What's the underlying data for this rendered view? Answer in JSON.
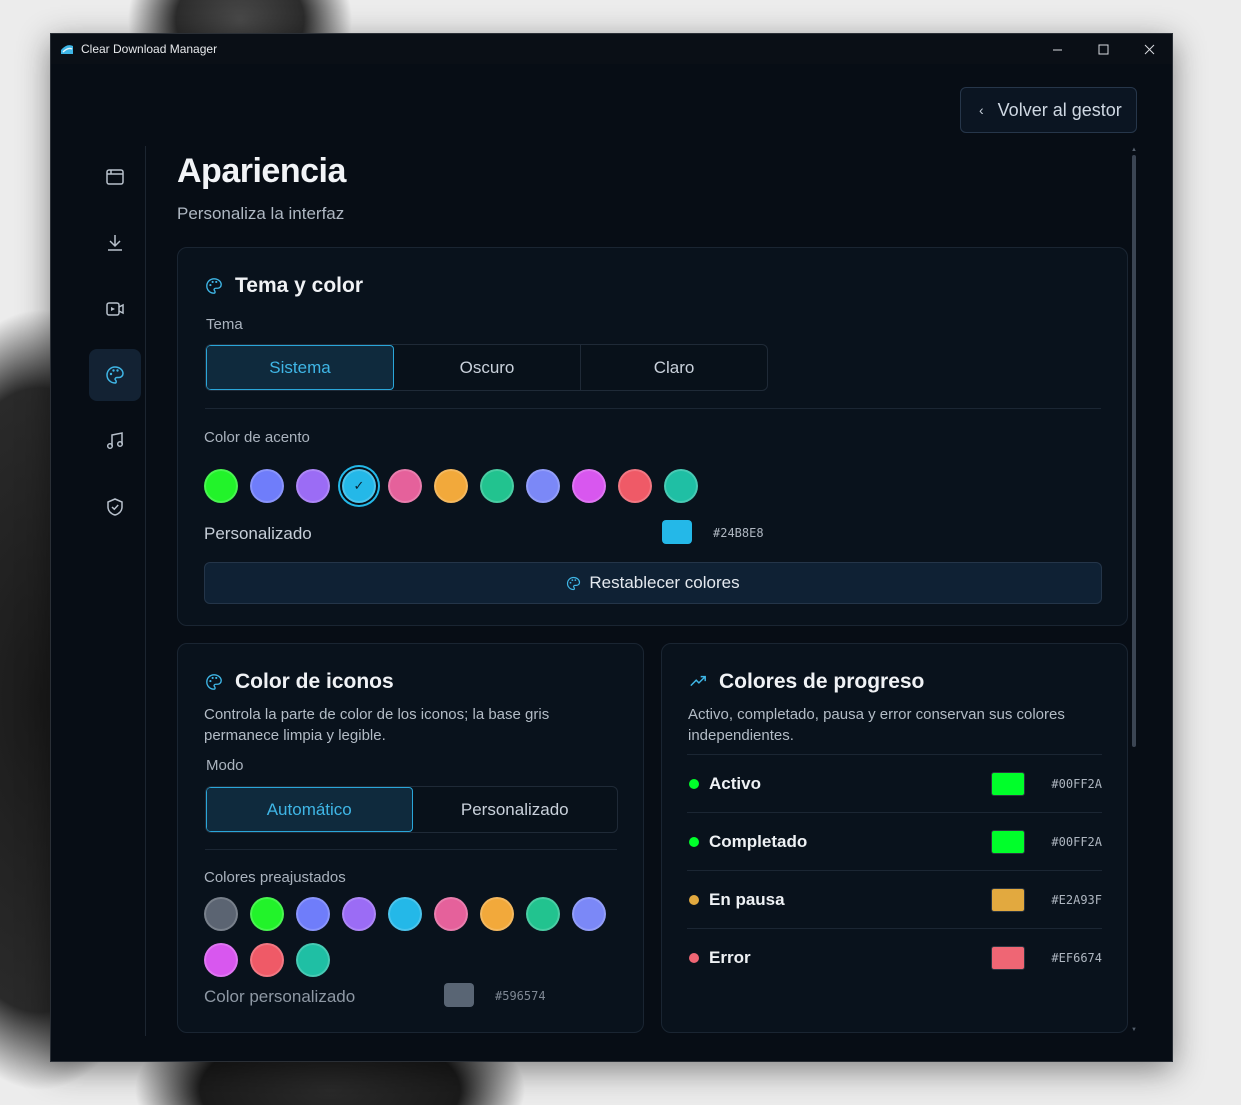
{
  "window": {
    "title": "Clear Download Manager"
  },
  "header": {
    "back_label": "Volver al gestor"
  },
  "sidebar": {
    "items": [
      {
        "name": "browser-window-icon",
        "active": false
      },
      {
        "name": "download-icon",
        "active": false
      },
      {
        "name": "video-icon",
        "active": false
      },
      {
        "name": "palette-icon",
        "active": true
      },
      {
        "name": "music-icon",
        "active": false
      },
      {
        "name": "shield-icon",
        "active": false
      }
    ]
  },
  "page": {
    "title": "Apariencia",
    "subtitle": "Personaliza la interfaz"
  },
  "theme_card": {
    "title": "Tema y color",
    "theme_label": "Tema",
    "themes": [
      "Sistema",
      "Oscuro",
      "Claro"
    ],
    "selected_theme": "Sistema",
    "accent_label": "Color de acento",
    "accent_colors": [
      "#22f32a",
      "#6f7dfa",
      "#9b6cf5",
      "#24b8e8",
      "#e5619b",
      "#f2a93b",
      "#22c38f",
      "#7b88f7",
      "#d857ef",
      "#ef5a67",
      "#1fbfa4"
    ],
    "selected_accent_index": 3,
    "custom_label": "Personalizado",
    "custom_color": "#24B8E8",
    "reset_label": "Restablecer colores"
  },
  "icon_card": {
    "title": "Color de iconos",
    "description": "Controla la parte de color de los iconos; la base gris permanece limpia y legible.",
    "mode_label": "Modo",
    "modes": [
      "Automático",
      "Personalizado"
    ],
    "selected_mode": "Automático",
    "presets_label": "Colores preajustados",
    "preset_colors": [
      "#5b6472",
      "#22f32a",
      "#6f7dfa",
      "#9b6cf5",
      "#24b8e8",
      "#e5619b",
      "#f2a93b",
      "#22c38f",
      "#7b88f7",
      "#d857ef",
      "#ef5a67",
      "#1fbfa4"
    ],
    "custom_label": "Color personalizado",
    "custom_color": "#596574"
  },
  "progress_card": {
    "title": "Colores de progreso",
    "description": "Activo, completado, pausa y error conservan sus colores independientes.",
    "rows": [
      {
        "name": "Activo",
        "color": "#00FF2A"
      },
      {
        "name": "Completado",
        "color": "#00FF2A"
      },
      {
        "name": "En pausa",
        "color": "#E2A93F"
      },
      {
        "name": "Error",
        "color": "#EF6674"
      }
    ]
  }
}
